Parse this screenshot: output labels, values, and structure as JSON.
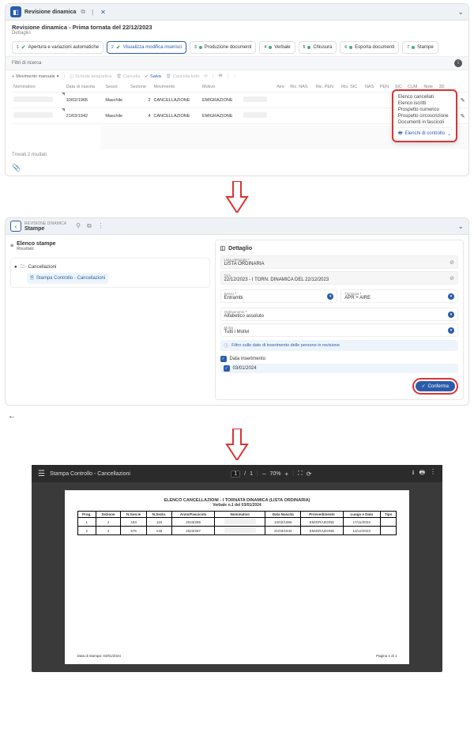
{
  "panel1": {
    "tab_title": "Revisione dinamica",
    "heading": "Revisione dinamica - Prima tornata del 22/12/2023",
    "sub": "Dettaglio",
    "steps": [
      {
        "n": "1",
        "label": "Apertura e variazioni automatiche",
        "checked": true
      },
      {
        "n": "2",
        "label": "Visualizza modifica inserisci",
        "checked": true,
        "selected": true
      },
      {
        "n": "3",
        "label": "Produzione documenti"
      },
      {
        "n": "4",
        "label": "Verbale"
      },
      {
        "n": "5",
        "label": "Chiusura"
      },
      {
        "n": "6",
        "label": "Esporta documenti"
      },
      {
        "n": "7",
        "label": "Stampe"
      }
    ],
    "filter_label": "Filtri di ricerca",
    "toolbar": {
      "add": "Movimento manuale",
      "scheda": "Scheda anagrafica",
      "cancella": "Cancella",
      "salva": "Salva",
      "cancella_tutto": "Cancella tutto"
    },
    "columns": [
      "Nominativo",
      "Data di nascita",
      "Sesso",
      "Sezione",
      "Movimento",
      "Motivo",
      "",
      "Aire",
      "Ric. NAS",
      "Ric. PEN",
      "Ris. SIC",
      "NAS",
      "PEN",
      "SIC",
      "CUM",
      "Note",
      "3D",
      "",
      ""
    ],
    "rows": [
      {
        "dob": "10/02/1965",
        "sesso": "Maschile",
        "sez": "2",
        "mov": "CANCELLAZIONE",
        "motivo": "EMIGRAZIONE"
      },
      {
        "dob": "21/03/1942",
        "sesso": "Maschile",
        "sez": "4",
        "mov": "CANCELLAZIONE",
        "motivo": "EMIGRAZIONE"
      }
    ],
    "results_text": "Trovati 2 risultati",
    "popup": {
      "items": [
        "Elenco cancellati",
        "Elenco iscritti",
        "Prospetto numerico",
        "Prospetto circoscrizione",
        "Documenti in fascicoli"
      ],
      "header": "Elenchi di controllo"
    }
  },
  "panel2": {
    "crumb_top": "REVISIONE DINAMICA",
    "crumb_main": "Stampe",
    "left_title": "Elenco stampe",
    "left_sub": "Risultati",
    "tree_root": "Cancellazioni",
    "tree_child": "Stampa Controllo - Cancellazioni",
    "right_title": "Dettaglio",
    "fields": {
      "lista": {
        "lab": "Lista elettorale",
        "val": "LISTA ORDINARIA"
      },
      "torn": {
        "lab": "Torn.",
        "val": "22/12/2023 - I TORN. DINAMICA DEL 22/12/2023"
      },
      "sesso": {
        "lab": "Sesso",
        "val": "Entrambi"
      },
      "tipologia": {
        "lab": "Tipologia",
        "val": "APR + AIRE"
      },
      "ordinamento": {
        "lab": "Ordinamento",
        "val": "Alfabetico assoluto"
      },
      "motivi": {
        "lab": "Motivi",
        "val": "Tutti i Motivi"
      }
    },
    "info": "Filtro sulle date di inserimento delle persone in revisione",
    "chk1": "Data inserimento",
    "chk2_val": "03/01/2024",
    "confirm": "Conferma"
  },
  "pdf": {
    "title": "Stampa Controllo - Cancellazioni",
    "page_cur": "1",
    "page_tot": "1",
    "zoom": "70%",
    "doc_title": "ELENCO CANCELLAZIONI - I TORNATA DINAMICA (LISTA ORDINARIA)",
    "doc_sub": "Verbale n.1 del 03/01/2024",
    "cols": [
      "Prog.",
      "Sezione",
      "N.Gen.le",
      "N.Sezio.",
      "Anno/Fascicolo",
      "Nominativo",
      "Data Nascita",
      "Provvedimento",
      "Luogo e Data",
      "Tipo"
    ],
    "rows": [
      [
        "1",
        "2",
        "183",
        "118",
        "2023/286",
        "",
        "10/02/1965",
        "EMIGRAZIONE",
        "17/11/2023",
        ""
      ],
      [
        "2",
        "4",
        "575",
        "145",
        "2023/287",
        "",
        "21/03/1942",
        "EMIGRAZIONE",
        "13/12/2023",
        ""
      ]
    ],
    "foot_left": "Data di stampa: 03/01/2024",
    "foot_right": "Pagina 1 di 1"
  }
}
